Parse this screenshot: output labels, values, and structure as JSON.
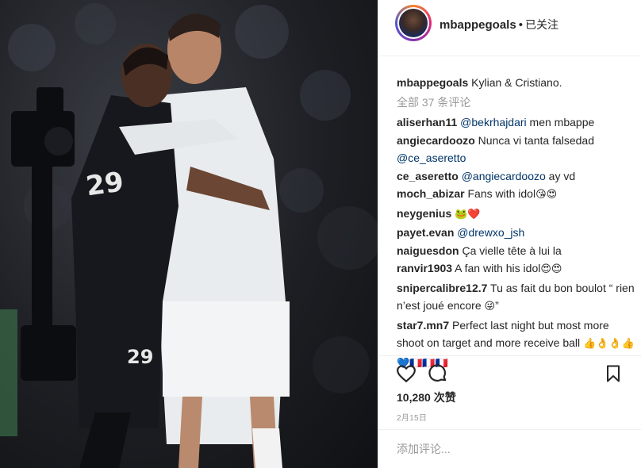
{
  "header": {
    "username": "mbappegoals",
    "separator": "•",
    "follow_status": "已关注"
  },
  "caption": {
    "username": "mbappegoals",
    "text": "Kylian & Cristiano."
  },
  "view_all_comments": "全部 37 条评论",
  "comments": [
    {
      "user": "aliserhan11",
      "mention": "@bekrhajdari",
      "text": " men mbappe",
      "emoji": ""
    },
    {
      "user": "angiecardoozo",
      "mention": "",
      "text": " Nunca vi tanta falsedad",
      "mention2": "@ce_aseretto",
      "emoji": ""
    },
    {
      "user": "ce_aseretto",
      "mention": "@angiecardoozo",
      "text": " ay vd",
      "emoji": ""
    },
    {
      "user": "moch_abizar",
      "mention": "",
      "text": " Fans with idol",
      "emoji": "😘😍"
    },
    {
      "user": "neygenius",
      "mention": "",
      "text": " ",
      "emoji": "🐸❤️"
    },
    {
      "user": "payet.evan",
      "mention": "@drewxo_jsh",
      "text": "",
      "emoji": ""
    },
    {
      "user": "naiguesdon",
      "mention": "",
      "text": " Ça vielle tête à lui la",
      "emoji": ""
    },
    {
      "user": "ranvir1903",
      "mention": "",
      "text": " A fan with his idol",
      "emoji": "😍😍"
    },
    {
      "user": "snipercalibre12.7",
      "mention": "",
      "text": " Tu as fait du bon boulot “ rien n’est joué encore ",
      "emoji": "😜",
      "tail": "”"
    },
    {
      "user": "star7.mn7",
      "mention": "",
      "text": " Perfect last night but most more shoot on target and more receive ball ",
      "emoji": "👍👌👌👍💙🇫🇷🇫🇷🇫🇷"
    }
  ],
  "actions": {
    "like_icon": "heart-icon",
    "comment_icon": "comment-bubble-icon",
    "save_icon": "bookmark-icon"
  },
  "likes": "10,280 次赞",
  "date": "2月15日",
  "add_comment_placeholder": "添加评论...",
  "photo": {
    "jersey_left": "29",
    "jersey_right_back": "29"
  },
  "colors": {
    "text": "#262626",
    "muted": "#999999",
    "mention": "#003569",
    "border": "#efefef"
  }
}
